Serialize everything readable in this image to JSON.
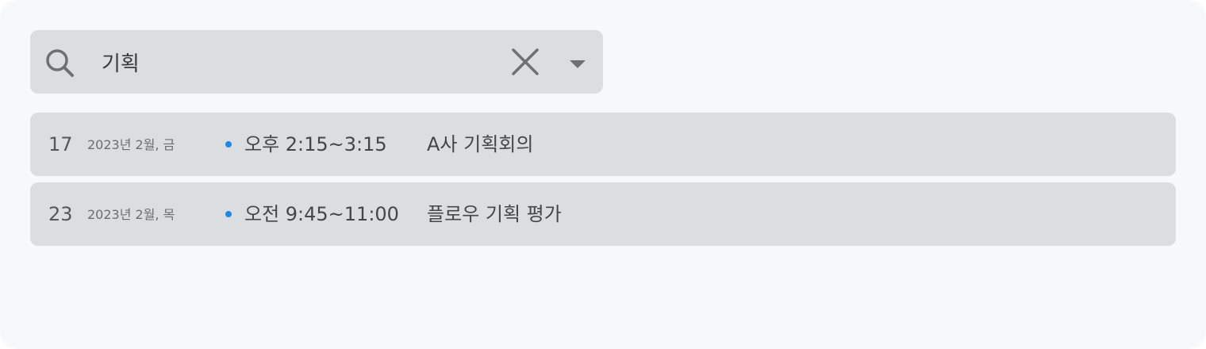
{
  "search": {
    "query": "기획",
    "placeholder": ""
  },
  "icons": {
    "search": "search-icon",
    "clear": "close-icon",
    "dropdown": "caret-down-icon"
  },
  "colors": {
    "event_dot": "#1e88e5",
    "panel_background": "#f7f8fa",
    "field_background": "#dcdde0"
  },
  "results": [
    {
      "day": "17",
      "date": "2023년 2월, 금",
      "time": "오후 2:15~3:15",
      "title": "A사 기획회의"
    },
    {
      "day": "23",
      "date": "2023년 2월, 목",
      "time": "오전 9:45~11:00",
      "title": "플로우 기획 평가"
    }
  ]
}
